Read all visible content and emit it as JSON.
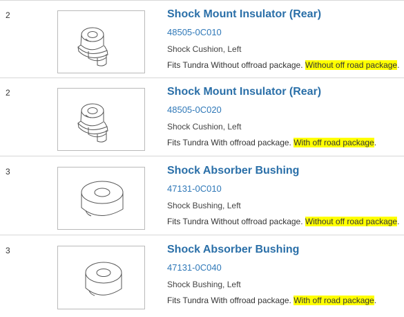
{
  "parts": [
    {
      "qty": "2",
      "title": "Shock Mount Insulator (Rear)",
      "part_number": "48505-0C010",
      "description": "Shock Cushion, Left",
      "fits_prefix": "Fits Tundra Without offroad package.",
      "fits_highlight": "Without off road package",
      "fits_suffix": ".",
      "image_icon": "shock-mount-insulator-icon"
    },
    {
      "qty": "2",
      "title": "Shock Mount Insulator (Rear)",
      "part_number": "48505-0C020",
      "description": "Shock Cushion, Left",
      "fits_prefix": "Fits Tundra With offroad package.",
      "fits_highlight": "With off road package",
      "fits_suffix": ".",
      "image_icon": "shock-mount-insulator-icon"
    },
    {
      "qty": "3",
      "title": "Shock Absorber Bushing",
      "part_number": "47131-0C010",
      "description": "Shock Bushing, Left",
      "fits_prefix": "Fits Tundra Without offroad package.",
      "fits_highlight": "Without off road package",
      "fits_suffix": ".",
      "image_icon": "shock-bushing-icon"
    },
    {
      "qty": "3",
      "title": "Shock Absorber Bushing",
      "part_number": "47131-0C040",
      "description": "Shock Bushing, Left",
      "fits_prefix": "Fits Tundra With offroad package.",
      "fits_highlight": "With off road package",
      "fits_suffix": ".",
      "image_icon": "shock-bushing-icon"
    }
  ],
  "colors": {
    "title_link": "#2a6fa8",
    "part_number_link": "#2f78b8",
    "highlight": "#ffff00",
    "divider": "#d7d7d7"
  }
}
